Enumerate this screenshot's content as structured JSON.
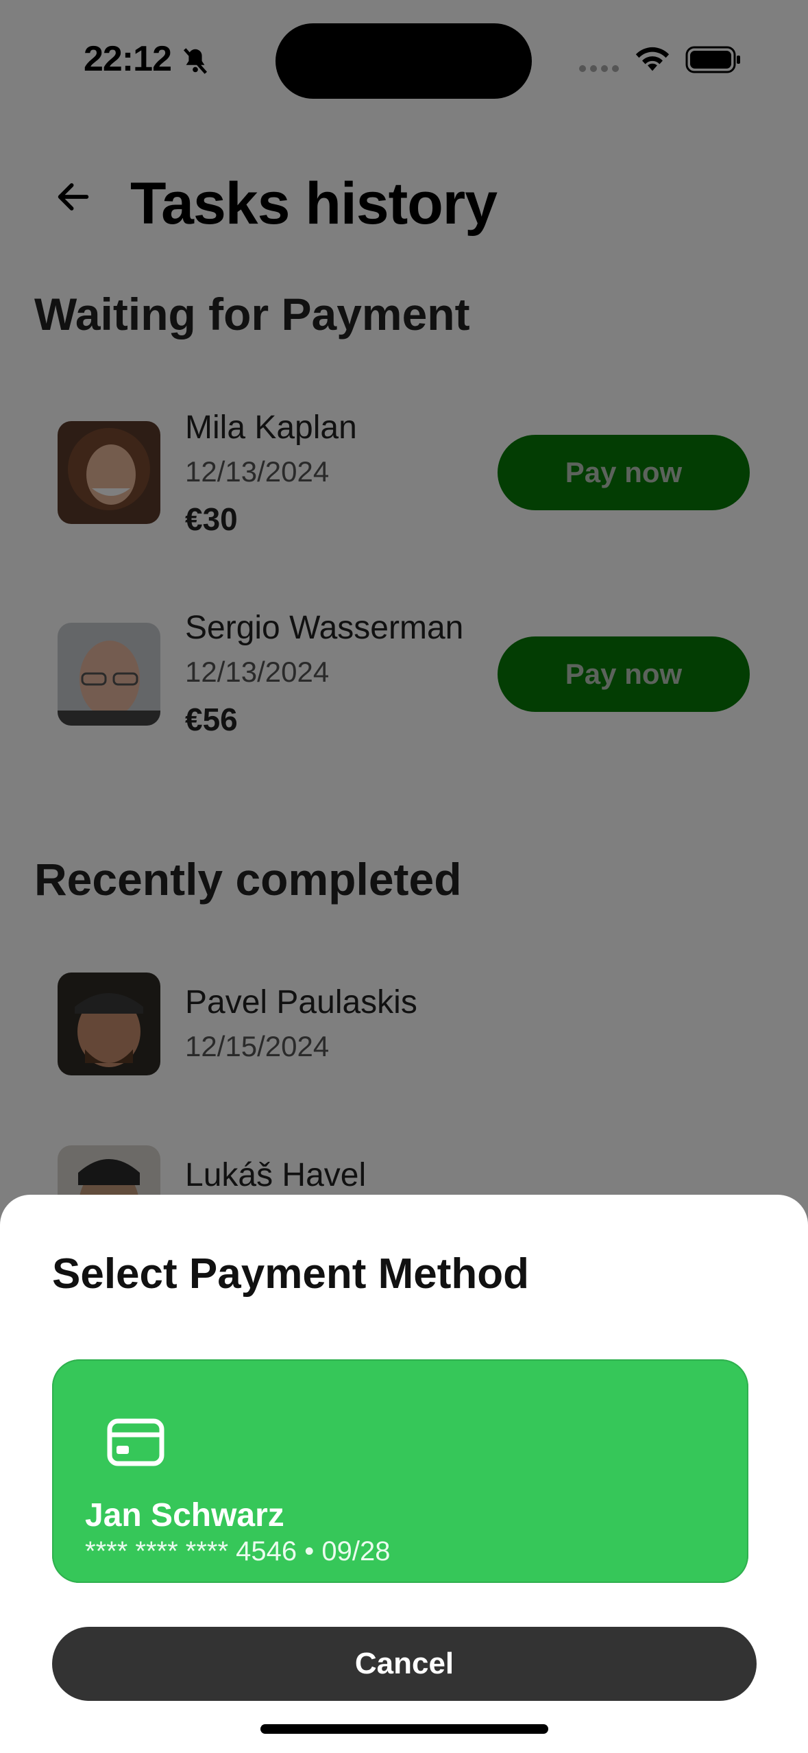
{
  "status_bar": {
    "time": "22:12"
  },
  "header": {
    "title": "Tasks history"
  },
  "waiting": {
    "heading": "Waiting for Payment",
    "items": [
      {
        "name": "Mila Kaplan",
        "date": "12/13/2024",
        "amount": "€30",
        "button": "Pay now"
      },
      {
        "name": "Sergio Wasserman",
        "date": "12/13/2024",
        "amount": "€56",
        "button": "Pay now"
      }
    ]
  },
  "completed": {
    "heading": "Recently completed",
    "items": [
      {
        "name": "Pavel Paulaskis",
        "date": "12/15/2024"
      },
      {
        "name": "Lukáš Havel"
      }
    ]
  },
  "sheet": {
    "title": "Select Payment Method",
    "card": {
      "holder": "Jan Schwarz",
      "number": "**** **** **** 4546 • 09/28",
      "icon": "credit-card-icon",
      "color": "#36c759"
    },
    "cancel": "Cancel"
  },
  "colors": {
    "pay_button": "#067a06",
    "cancel_button": "#333333"
  }
}
